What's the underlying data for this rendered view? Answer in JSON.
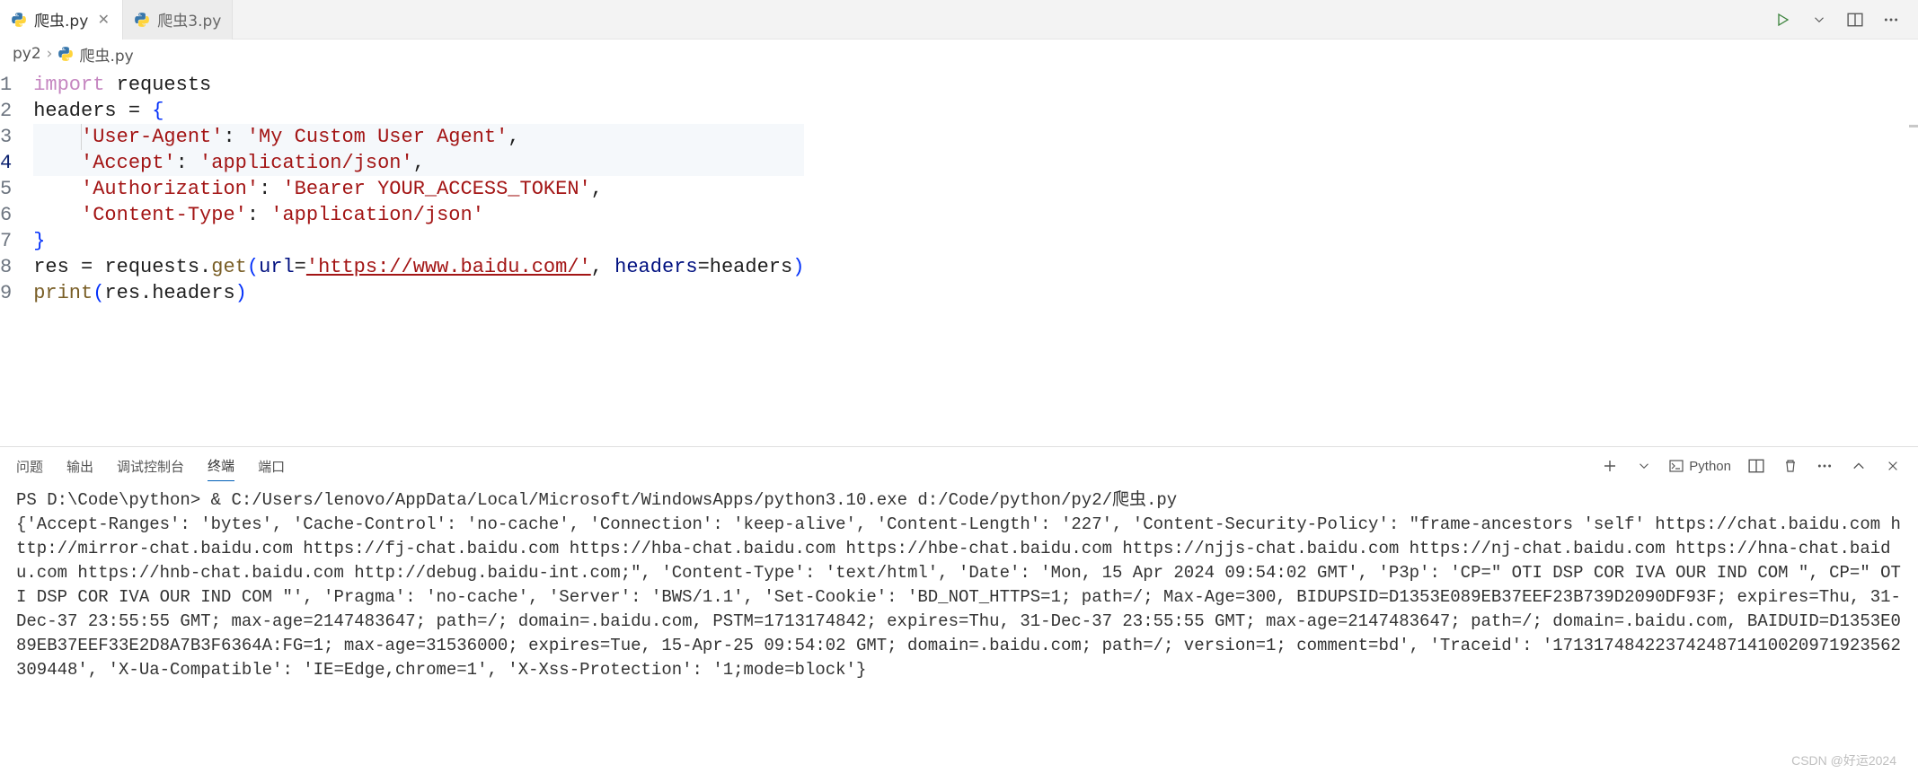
{
  "tabs": [
    {
      "label": "爬虫.py",
      "active": true
    },
    {
      "label": "爬虫3.py",
      "active": false
    }
  ],
  "breadcrumbs": {
    "folder": "py2",
    "file": "爬虫.py"
  },
  "code": {
    "line1": {
      "kw": "import",
      "mod": "requests"
    },
    "line2": {
      "lhs": "headers ",
      "op": "= ",
      "brace": "{"
    },
    "line3": {
      "key": "'User-Agent'",
      "colon": ": ",
      "val": "'My Custom User Agent'",
      "comma": ","
    },
    "line4": {
      "key": "'Accept'",
      "colon": ": ",
      "val": "'application/json'",
      "comma": ","
    },
    "line5": {
      "key": "'Authorization'",
      "colon": ": ",
      "val": "'Bearer YOUR_ACCESS_TOKEN'",
      "comma": ","
    },
    "line6": {
      "key": "'Content-Type'",
      "colon": ": ",
      "val": "'application/json'"
    },
    "line7": {
      "brace": "}"
    },
    "line8": {
      "lhs": "res ",
      "op": "= ",
      "obj": "requests",
      "dot": ".",
      "method": "get",
      "lp": "(",
      "p1": "url",
      "eq1": "=",
      "url": "'https://www.baidu.com/'",
      "c1": ", ",
      "p2": "headers",
      "eq2": "=",
      "arg2": "headers",
      "rp": ")"
    },
    "line9": {
      "fn": "print",
      "lp": "(",
      "obj": "res",
      "dot": ".",
      "attr": "headers",
      "rp": ")"
    }
  },
  "panel": {
    "tabs": {
      "problems": "问题",
      "output": "输出",
      "debug": "调试控制台",
      "terminal": "终端",
      "ports": "端口"
    },
    "python_label": "Python"
  },
  "terminal": {
    "prompt": "PS D:\\Code\\python> ",
    "cmd": "& C:/Users/lenovo/AppData/Local/Microsoft/WindowsApps/python3.10.exe d:/Code/python/py2/爬虫.py",
    "output": "{'Accept-Ranges': 'bytes', 'Cache-Control': 'no-cache', 'Connection': 'keep-alive', 'Content-Length': '227', 'Content-Security-Policy': \"frame-ancestors 'self' https://chat.baidu.com http://mirror-chat.baidu.com https://fj-chat.baidu.com https://hba-chat.baidu.com https://hbe-chat.baidu.com https://njjs-chat.baidu.com https://nj-chat.baidu.com https://hna-chat.baidu.com https://hnb-chat.baidu.com http://debug.baidu-int.com;\", 'Content-Type': 'text/html', 'Date': 'Mon, 15 Apr 2024 09:54:02 GMT', 'P3p': 'CP=\" OTI DSP COR IVA OUR IND COM \", CP=\" OTI DSP COR IVA OUR IND COM \"', 'Pragma': 'no-cache', 'Server': 'BWS/1.1', 'Set-Cookie': 'BD_NOT_HTTPS=1; path=/; Max-Age=300, BIDUPSID=D1353E089EB37EEF23B739D2090DF93F; expires=Thu, 31-Dec-37 23:55:55 GMT; max-age=2147483647; path=/; domain=.baidu.com, PSTM=1713174842; expires=Thu, 31-Dec-37 23:55:55 GMT; max-age=2147483647; path=/; domain=.baidu.com, BAIDUID=D1353E089EB37EEF33E2D8A7B3F6364A:FG=1; max-age=31536000; expires=Tue, 15-Apr-25 09:54:02 GMT; domain=.baidu.com; path=/; version=1; comment=bd', 'Traceid': '1713174842237424871410020971923562309448', 'X-Ua-Compatible': 'IE=Edge,chrome=1', 'X-Xss-Protection': '1;mode=block'}"
  },
  "watermark": "CSDN @好运2024"
}
